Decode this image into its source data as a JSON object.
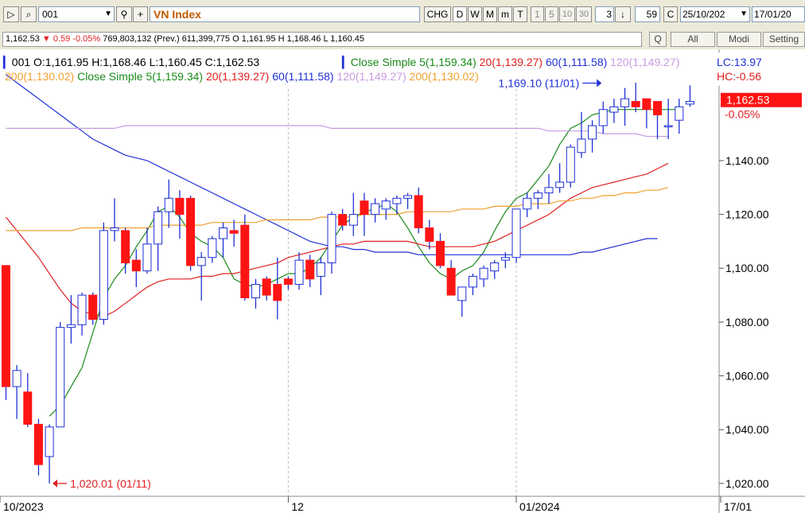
{
  "toolbar": {
    "symbol": "001",
    "title": "VN Index",
    "chg": "CHG",
    "periods": [
      "D",
      "W",
      "M",
      "m",
      "T"
    ],
    "minutes": [
      "1",
      "5",
      "10",
      "30"
    ],
    "step": "3",
    "count": "59",
    "c_label": "C",
    "from_date": "25/10/202",
    "to_date": "17/01/20"
  },
  "infobar": {
    "prefix": "1,162.53",
    "change": "▼ 0.59 -0.05%",
    "rest": "769,803,132 (Prev.) 611,399,775 O 1,161.95 H 1,168.46 L 1,160.45",
    "buttons": [
      "Q",
      "All",
      "Modi",
      "Setting"
    ]
  },
  "legend": {
    "ohlc": "001 O:1,161.95 H:1,168.46 L:1,160.45 C:1,162.53",
    "ma_line1": [
      {
        "text": "Close Simple 5(1,159.34)",
        "color": "#1a8a1a"
      },
      {
        "text": "20(1,139.27)",
        "color": "#e02020"
      },
      {
        "text": "60(1,111.58)",
        "color": "#1f30d6"
      },
      {
        "text": "120(1,149.27)",
        "color": "#c89be0"
      }
    ],
    "ma_line2": [
      {
        "text": "200(1,130.02)",
        "color": "#f0a030"
      },
      {
        "text": "Close Simple 5(1,159.34)",
        "color": "#1a8a1a"
      },
      {
        "text": "20(1,139.27)",
        "color": "#e02020"
      },
      {
        "text": "60(1,111.58)",
        "color": "#1f30d6"
      },
      {
        "text": "120(1,149.27)",
        "color": "#c89be0"
      },
      {
        "text": "200(1,130.02)",
        "color": "#f0a030"
      }
    ],
    "lc": "LC:13.97",
    "hc": "HC:-0.56"
  },
  "chart_data": {
    "type": "candlestick",
    "y_ticks": [
      1020,
      1040,
      1060,
      1080,
      1100,
      1120,
      1140
    ],
    "y_tick_labels": [
      "1,020.00",
      "1,040.00",
      "1,060.00",
      "1,080.00",
      "1,100.00",
      "1,120.00",
      "1,140.00"
    ],
    "ylim": [
      1017,
      1166
    ],
    "x_labels": [
      {
        "label": "10/2023",
        "index": 0
      },
      {
        "label": "12",
        "index": 26
      },
      {
        "label": "01/2024",
        "index": 47
      },
      {
        "label": "17/01",
        "index": 64
      }
    ],
    "last_price": {
      "value": 1162.53,
      "label": "1,162.53",
      "change": "-0.05%"
    },
    "annotations": [
      {
        "text": "1,169.10 (11/01)",
        "index": 55,
        "value": 1169.1,
        "color": "#1f30d6",
        "side": "left"
      },
      {
        "text": "1,020.01 (01/11)",
        "index": 4,
        "value": 1020.01,
        "color": "#e02020",
        "side": "right"
      }
    ],
    "candles": [
      {
        "o": 1101,
        "h": 1101,
        "l": 1051,
        "c": 1056
      },
      {
        "o": 1056,
        "h": 1064,
        "l": 1044,
        "c": 1062
      },
      {
        "o": 1054,
        "h": 1061,
        "l": 1041,
        "c": 1042
      },
      {
        "o": 1042,
        "h": 1044,
        "l": 1023,
        "c": 1027
      },
      {
        "o": 1030,
        "h": 1042,
        "l": 1020,
        "c": 1041
      },
      {
        "o": 1041,
        "h": 1080,
        "l": 1041,
        "c": 1078
      },
      {
        "o": 1078,
        "h": 1090,
        "l": 1072,
        "c": 1079
      },
      {
        "o": 1079,
        "h": 1091,
        "l": 1075,
        "c": 1090
      },
      {
        "o": 1090,
        "h": 1091,
        "l": 1079,
        "c": 1081
      },
      {
        "o": 1081,
        "h": 1117,
        "l": 1079,
        "c": 1114
      },
      {
        "o": 1114,
        "h": 1126,
        "l": 1110,
        "c": 1115
      },
      {
        "o": 1114,
        "h": 1115,
        "l": 1098,
        "c": 1102
      },
      {
        "o": 1103,
        "h": 1107,
        "l": 1093,
        "c": 1099
      },
      {
        "o": 1099,
        "h": 1115,
        "l": 1098,
        "c": 1109
      },
      {
        "o": 1109,
        "h": 1123,
        "l": 1099,
        "c": 1121
      },
      {
        "o": 1121,
        "h": 1133,
        "l": 1115,
        "c": 1126
      },
      {
        "o": 1126,
        "h": 1129,
        "l": 1111,
        "c": 1120
      },
      {
        "o": 1126,
        "h": 1127,
        "l": 1099,
        "c": 1101
      },
      {
        "o": 1101,
        "h": 1106,
        "l": 1088,
        "c": 1104
      },
      {
        "o": 1104,
        "h": 1112,
        "l": 1102,
        "c": 1111
      },
      {
        "o": 1111,
        "h": 1117,
        "l": 1104,
        "c": 1115
      },
      {
        "o": 1114,
        "h": 1118,
        "l": 1108,
        "c": 1113
      },
      {
        "o": 1116,
        "h": 1120,
        "l": 1088,
        "c": 1089
      },
      {
        "o": 1089,
        "h": 1096,
        "l": 1085,
        "c": 1094
      },
      {
        "o": 1096,
        "h": 1097,
        "l": 1088,
        "c": 1090
      },
      {
        "o": 1094,
        "h": 1104,
        "l": 1081,
        "c": 1088
      },
      {
        "o": 1096,
        "h": 1097,
        "l": 1092,
        "c": 1094
      },
      {
        "o": 1094,
        "h": 1106,
        "l": 1092,
        "c": 1103
      },
      {
        "o": 1103,
        "h": 1105,
        "l": 1093,
        "c": 1096
      },
      {
        "o": 1097,
        "h": 1104,
        "l": 1090,
        "c": 1102
      },
      {
        "o": 1102,
        "h": 1121,
        "l": 1098,
        "c": 1120
      },
      {
        "o": 1120,
        "h": 1122,
        "l": 1114,
        "c": 1116
      },
      {
        "o": 1116,
        "h": 1128,
        "l": 1112,
        "c": 1120
      },
      {
        "o": 1125,
        "h": 1128,
        "l": 1112,
        "c": 1120
      },
      {
        "o": 1120,
        "h": 1126,
        "l": 1117,
        "c": 1124
      },
      {
        "o": 1122,
        "h": 1126,
        "l": 1118,
        "c": 1125
      },
      {
        "o": 1124,
        "h": 1127,
        "l": 1120,
        "c": 1126
      },
      {
        "o": 1126,
        "h": 1128,
        "l": 1122,
        "c": 1127
      },
      {
        "o": 1127,
        "h": 1130,
        "l": 1113,
        "c": 1115
      },
      {
        "o": 1115,
        "h": 1118,
        "l": 1107,
        "c": 1110
      },
      {
        "o": 1110,
        "h": 1113,
        "l": 1100,
        "c": 1101
      },
      {
        "o": 1100,
        "h": 1103,
        "l": 1090,
        "c": 1090
      },
      {
        "o": 1088,
        "h": 1093,
        "l": 1082,
        "c": 1093
      },
      {
        "o": 1093,
        "h": 1098,
        "l": 1090,
        "c": 1097
      },
      {
        "o": 1096,
        "h": 1101,
        "l": 1093,
        "c": 1100
      },
      {
        "o": 1099,
        "h": 1103,
        "l": 1096,
        "c": 1102
      },
      {
        "o": 1103,
        "h": 1106,
        "l": 1100,
        "c": 1104
      },
      {
        "o": 1104,
        "h": 1122,
        "l": 1102,
        "c": 1122
      },
      {
        "o": 1122,
        "h": 1128,
        "l": 1119,
        "c": 1126
      },
      {
        "o": 1126,
        "h": 1129,
        "l": 1122,
        "c": 1128
      },
      {
        "o": 1128,
        "h": 1135,
        "l": 1124,
        "c": 1130
      },
      {
        "o": 1130,
        "h": 1139,
        "l": 1128,
        "c": 1132
      },
      {
        "o": 1132,
        "h": 1146,
        "l": 1130,
        "c": 1145
      },
      {
        "o": 1143,
        "h": 1158,
        "l": 1141,
        "c": 1148
      },
      {
        "o": 1148,
        "h": 1155,
        "l": 1143,
        "c": 1153
      },
      {
        "o": 1153,
        "h": 1162,
        "l": 1150,
        "c": 1159
      },
      {
        "o": 1158,
        "h": 1163,
        "l": 1154,
        "c": 1160
      },
      {
        "o": 1160,
        "h": 1167,
        "l": 1153,
        "c": 1163
      },
      {
        "o": 1162,
        "h": 1169,
        "l": 1158,
        "c": 1160
      },
      {
        "o": 1163,
        "h": 1163,
        "l": 1152,
        "c": 1159
      },
      {
        "o": 1162,
        "h": 1162,
        "l": 1148,
        "c": 1157
      },
      {
        "o": 1153,
        "h": 1163,
        "l": 1148,
        "c": 1153
      },
      {
        "o": 1155,
        "h": 1163,
        "l": 1150,
        "c": 1160
      },
      {
        "o": 1161,
        "h": 1168,
        "l": 1160,
        "c": 1162
      }
    ],
    "series": [
      {
        "name": "Close Simple 5",
        "color": "#1a8a1a",
        "values": [
          null,
          null,
          null,
          null,
          1045,
          1049,
          1056,
          1063,
          1076,
          1089,
          1096,
          1101,
          1108,
          1114,
          1121,
          1123,
          1119,
          1113,
          1110,
          1108,
          1104,
          1096,
          1094,
          1093,
          1094,
          1096,
          1098,
          1098,
          1100,
          1104,
          1110,
          1116,
          1119,
          1121,
          1122,
          1124,
          1121,
          1115,
          1108,
          1102,
          1098,
          1096,
          1099,
          1101,
          1106,
          1114,
          1121,
          1126,
          1128,
          1133,
          1138,
          1146,
          1152,
          1154,
          1157,
          1158,
          1159,
          1159,
          1159,
          1159,
          1159,
          1159,
          1159
        ]
      },
      {
        "name": "20",
        "color": "#e02020",
        "values": [
          1119,
          1114,
          1109,
          1104,
          1098,
          1092,
          1087,
          1084,
          1083,
          1082,
          1084,
          1087,
          1090,
          1093,
          1095,
          1096,
          1096,
          1096,
          1097,
          1097,
          1098,
          1098,
          1099,
          1100,
          1101,
          1102,
          1104,
          1105,
          1106,
          1107,
          1108,
          1109,
          1109,
          1110,
          1110,
          1110,
          1110,
          1110,
          1109,
          1108,
          1108,
          1108,
          1108,
          1108,
          1109,
          1110,
          1112,
          1114,
          1116,
          1118,
          1120,
          1123,
          1126,
          1128,
          1130,
          1131,
          1132,
          1133,
          1134,
          1135,
          1137,
          1139
        ]
      },
      {
        "name": "60",
        "color": "#1f30d6",
        "values": [
          1172,
          1169,
          1166,
          1163,
          1160,
          1157,
          1154,
          1151,
          1148,
          1146,
          1144,
          1142,
          1141,
          1140,
          1138,
          1136,
          1134,
          1132,
          1130,
          1128,
          1126,
          1124,
          1122,
          1120,
          1118,
          1116,
          1114,
          1112,
          1110,
          1109,
          1108,
          1108,
          1107,
          1107,
          1106,
          1106,
          1106,
          1106,
          1105,
          1105,
          1105,
          1105,
          1105,
          1105,
          1105,
          1105,
          1105,
          1105,
          1105,
          1105,
          1105,
          1105,
          1105,
          1106,
          1106,
          1107,
          1108,
          1109,
          1110,
          1111,
          1111
        ]
      },
      {
        "name": "120",
        "color": "#c89be0",
        "values": [
          1152,
          1152,
          1152,
          1152,
          1152,
          1152,
          1152,
          1152,
          1152,
          1152,
          1152,
          1153,
          1153,
          1153,
          1153,
          1153,
          1153,
          1153,
          1153,
          1153,
          1153,
          1153,
          1153,
          1153,
          1153,
          1153,
          1153,
          1153,
          1153,
          1153,
          1152,
          1152,
          1152,
          1152,
          1152,
          1152,
          1152,
          1152,
          1152,
          1152,
          1152,
          1152,
          1152,
          1152,
          1152,
          1152,
          1152,
          1152,
          1152,
          1152,
          1151,
          1151,
          1151,
          1151,
          1151,
          1150,
          1150,
          1150,
          1150,
          1149,
          1149,
          1149
        ]
      },
      {
        "name": "200",
        "color": "#f0a030",
        "values": [
          1114,
          1114,
          1114,
          1114,
          1114,
          1114,
          1114,
          1115,
          1115,
          1115,
          1115,
          1115,
          1115,
          1115,
          1116,
          1116,
          1116,
          1116,
          1116,
          1117,
          1117,
          1117,
          1117,
          1117,
          1118,
          1118,
          1118,
          1118,
          1118,
          1119,
          1119,
          1119,
          1119,
          1120,
          1120,
          1120,
          1120,
          1121,
          1121,
          1121,
          1121,
          1121,
          1122,
          1122,
          1122,
          1123,
          1123,
          1123,
          1124,
          1124,
          1124,
          1125,
          1125,
          1126,
          1126,
          1127,
          1127,
          1128,
          1128,
          1129,
          1129,
          1130
        ]
      }
    ]
  }
}
